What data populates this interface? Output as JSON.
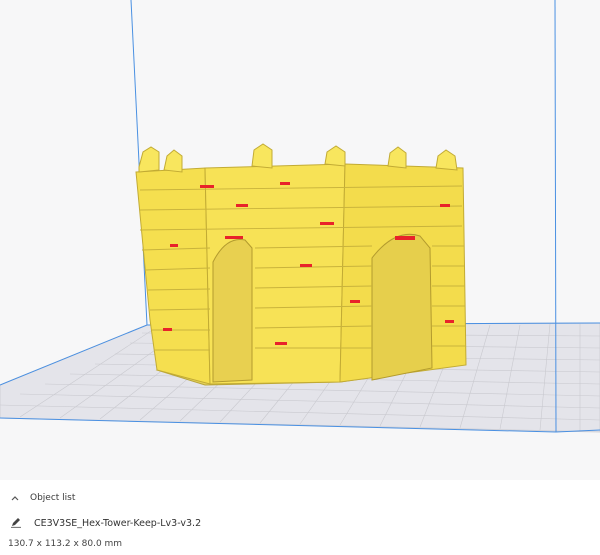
{
  "viewport": {
    "build_volume_color": "#4a90e2",
    "plate_color": "#e4e4ea",
    "grid_color": "#c6c6cc",
    "model_color": "#f7e256",
    "overhang_color": "#e8232a"
  },
  "object_list": {
    "toggle_icon": "chevron-up-icon",
    "label": "Object list"
  },
  "current_object": {
    "icon": "pencil-icon",
    "name": "CE3V3SE_Hex-Tower-Keep-Lv3-v3.2",
    "dimensions": "130.7 x 113.2 x 80.0 mm"
  }
}
